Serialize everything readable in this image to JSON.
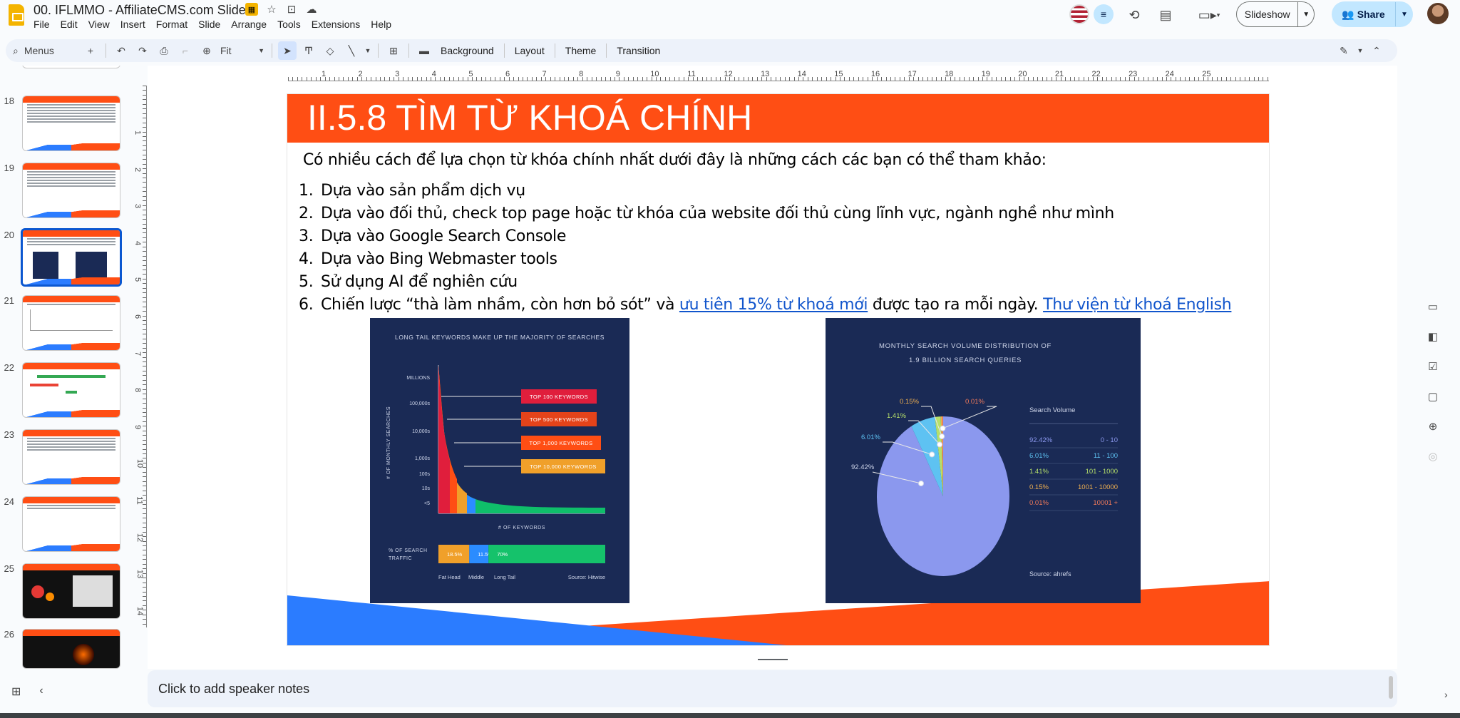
{
  "app": {
    "doc_title": "00. IFLMMO - AffiliateCMS.com Slides",
    "menus": [
      "File",
      "Edit",
      "View",
      "Insert",
      "Format",
      "Slide",
      "Arrange",
      "Tools",
      "Extensions",
      "Help"
    ],
    "slideshow_label": "Slideshow",
    "share_label": "Share"
  },
  "toolbar": {
    "search_label": "Menus",
    "zoom_label": "Fit",
    "background_label": "Background",
    "layout_label": "Layout",
    "theme_label": "Theme",
    "transition_label": "Transition"
  },
  "rail": {
    "slides": [
      {
        "num": "18"
      },
      {
        "num": "19"
      },
      {
        "num": "20",
        "selected": true
      },
      {
        "num": "21"
      },
      {
        "num": "22"
      },
      {
        "num": "23"
      },
      {
        "num": "24"
      },
      {
        "num": "25"
      },
      {
        "num": "26"
      }
    ]
  },
  "ruler": {
    "h_labels": [
      "1",
      "2",
      "3",
      "4",
      "5",
      "6",
      "7",
      "8",
      "9",
      "10",
      "11",
      "12",
      "13",
      "14",
      "15",
      "16",
      "17",
      "18",
      "19",
      "20",
      "21",
      "22",
      "23",
      "24",
      "25"
    ],
    "v_labels": [
      "1",
      "2",
      "3",
      "4",
      "5",
      "6",
      "7",
      "8",
      "9",
      "10",
      "11",
      "12",
      "13",
      "14"
    ]
  },
  "slide": {
    "title": "II.5.8 TÌM TỪ KHOÁ CHÍNH",
    "intro": "Có nhiều cách để lựa chọn từ khóa chính nhất dưới đây là những cách các bạn có thể tham khảo:",
    "items": [
      {
        "num": "1.",
        "text": "Dựa vào sản phẩm dịch vụ"
      },
      {
        "num": "2.",
        "text": "Dựa vào đối thủ, check top page hoặc từ khóa của website đối thủ cùng lĩnh vực, ngành nghề như mình"
      },
      {
        "num": "3.",
        "text": "Dựa vào Google Search Console"
      },
      {
        "num": "4.",
        "text": "Dựa vào Bing Webmaster tools"
      },
      {
        "num": "5.",
        "text": "Sử dụng AI để nghiên cứu"
      }
    ],
    "item6": {
      "num": "6.",
      "pre": "Chiến lược “thà làm nhầm, còn hơn bỏ sót” và ",
      "link1": "ưu tiên 15% từ khoá mới",
      "mid": " được tạo ra mỗi ngày. ",
      "link2": "Thư viện từ khoá English"
    }
  },
  "chart_data": [
    {
      "type": "area",
      "title": "LONG TAIL KEYWORDS MAKE UP THE MAJORITY OF SEARCHES",
      "xlabel": "# OF KEYWORDS",
      "ylabel": "# OF MONTHLY SEARCHES",
      "y_ticks": [
        "MILLIONS",
        "100,000s",
        "10,000s",
        "1,000s",
        "100s",
        "10s",
        "<5"
      ],
      "annotations": [
        "TOP 100 KEYWORDS",
        "TOP 500 KEYWORDS",
        "TOP 1,000 KEYWORDS",
        "TOP 10,000 KEYWORDS"
      ],
      "traffic_label": "% OF SEARCH TRAFFIC",
      "traffic_split": [
        {
          "name": "Fat Head",
          "value": 18.5,
          "label": "18.5%",
          "color": "#f0a02a"
        },
        {
          "name": "Middle",
          "value": 11.5,
          "label": "11.5%",
          "color": "#2b8cff"
        },
        {
          "name": "Long Tail",
          "value": 70,
          "label": "70%",
          "color": "#15c26b"
        }
      ],
      "source": "Source: Hitwise"
    },
    {
      "type": "pie",
      "title_line1": "MONTHLY SEARCH VOLUME DISTRIBUTION OF",
      "title_line2": "1.9 BILLION SEARCH QUERIES",
      "legend_title": "Search Volume",
      "slices": [
        {
          "label": "92.42%",
          "value": 92.42,
          "range": "0 - 10",
          "color": "#8b98ee"
        },
        {
          "label": "6.01%",
          "value": 6.01,
          "range": "11 - 100",
          "color": "#5ec2f2"
        },
        {
          "label": "1.41%",
          "value": 1.41,
          "range": "101 - 1000",
          "color": "#b6e06a"
        },
        {
          "label": "0.15%",
          "value": 0.15,
          "range": "1001 - 10000",
          "color": "#f0b050"
        },
        {
          "label": "0.01%",
          "value": 0.01,
          "range": "10001 +",
          "color": "#f07a5a"
        }
      ],
      "source": "Source: ahrefs"
    }
  ],
  "notes": {
    "placeholder": "Click to add speaker notes"
  },
  "colors": {
    "accent_orange": "#ff4e14",
    "accent_blue": "#2b7cff",
    "chart_bg": "#1a2a55",
    "link": "#1155cc",
    "selected": "#0b57d0"
  }
}
